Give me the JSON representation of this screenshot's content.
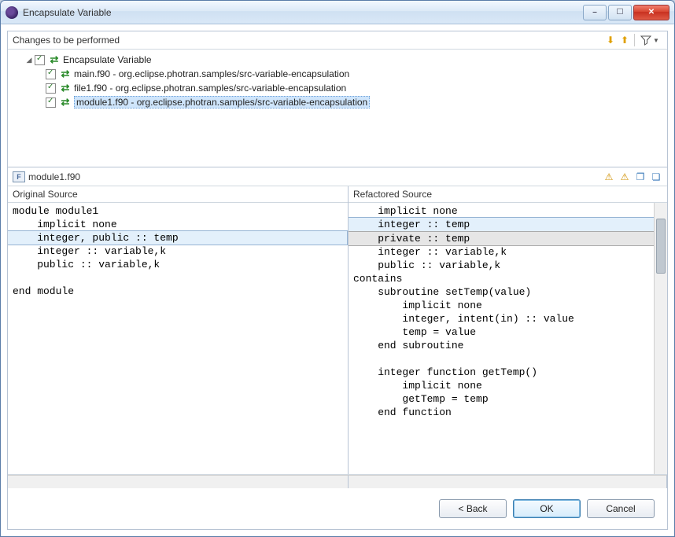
{
  "window": {
    "title": "Encapsulate Variable"
  },
  "changes": {
    "header": "Changes to be performed",
    "root_label": "Encapsulate Variable",
    "items": [
      {
        "filename": "main.f90",
        "location": "org.eclipse.photran.samples/src-variable-encapsulation",
        "sep": " - "
      },
      {
        "filename": "file1.f90",
        "location": "org.eclipse.photran.samples/src-variable-encapsulation",
        "sep": " - "
      },
      {
        "filename": "module1.f90",
        "location": "org.eclipse.photran.samples/src-variable-encapsulation",
        "sep": " - "
      }
    ]
  },
  "file_band": {
    "name": "module1.f90"
  },
  "compare": {
    "left_header": "Original Source",
    "right_header": "Refactored Source",
    "left_lines": [
      "module module1",
      "    implicit none",
      "    integer, public :: temp",
      "    integer :: variable,k",
      "    public :: variable,k",
      "",
      "end module"
    ],
    "right_lines": [
      "    implicit none",
      "    integer :: temp",
      "    private :: temp",
      "    integer :: variable,k",
      "    public :: variable,k",
      "contains",
      "    subroutine setTemp(value)",
      "        implicit none",
      "        integer, intent(in) :: value",
      "        temp = value",
      "    end subroutine",
      "",
      "    integer function getTemp()",
      "        implicit none",
      "        getTemp = temp",
      "    end function"
    ]
  },
  "buttons": {
    "back": "< Back",
    "ok": "OK",
    "cancel": "Cancel"
  }
}
